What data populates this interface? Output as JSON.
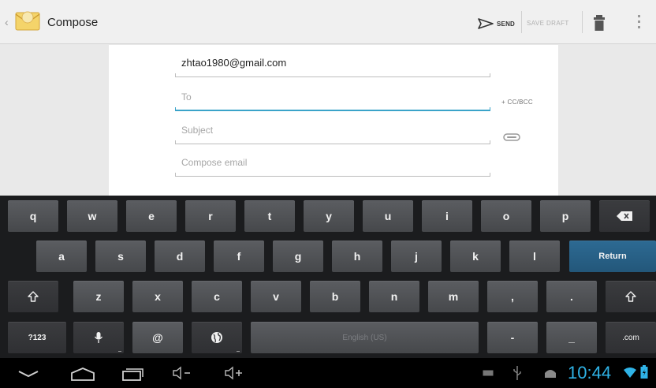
{
  "action_bar": {
    "title": "Compose",
    "send_label": "SEND",
    "save_draft_label": "SAVE DRAFT"
  },
  "compose": {
    "from_value": "zhtao1980@gmail.com",
    "to_placeholder": "To",
    "subject_placeholder": "Subject",
    "body_placeholder": "Compose email",
    "cc_bcc_label": "+ CC/BCC"
  },
  "keyboard": {
    "row1": [
      "q",
      "w",
      "e",
      "r",
      "t",
      "y",
      "u",
      "i",
      "o",
      "p"
    ],
    "row2": [
      "a",
      "s",
      "d",
      "f",
      "g",
      "h",
      "j",
      "k",
      "l"
    ],
    "row3": [
      "z",
      "x",
      "c",
      "v",
      "b",
      "n",
      "m",
      ",",
      "."
    ],
    "return_label": "Return",
    "symbols_label": "?123",
    "at_label": "@",
    "space_label": "English (US)",
    "dash_label": "-",
    "underscore_label": "_",
    "com_label": ".com"
  },
  "status": {
    "time": "10:44"
  },
  "colors": {
    "accent": "#3aa3c9",
    "clock": "#2fb3e7",
    "return_key": "#2d6a93"
  }
}
